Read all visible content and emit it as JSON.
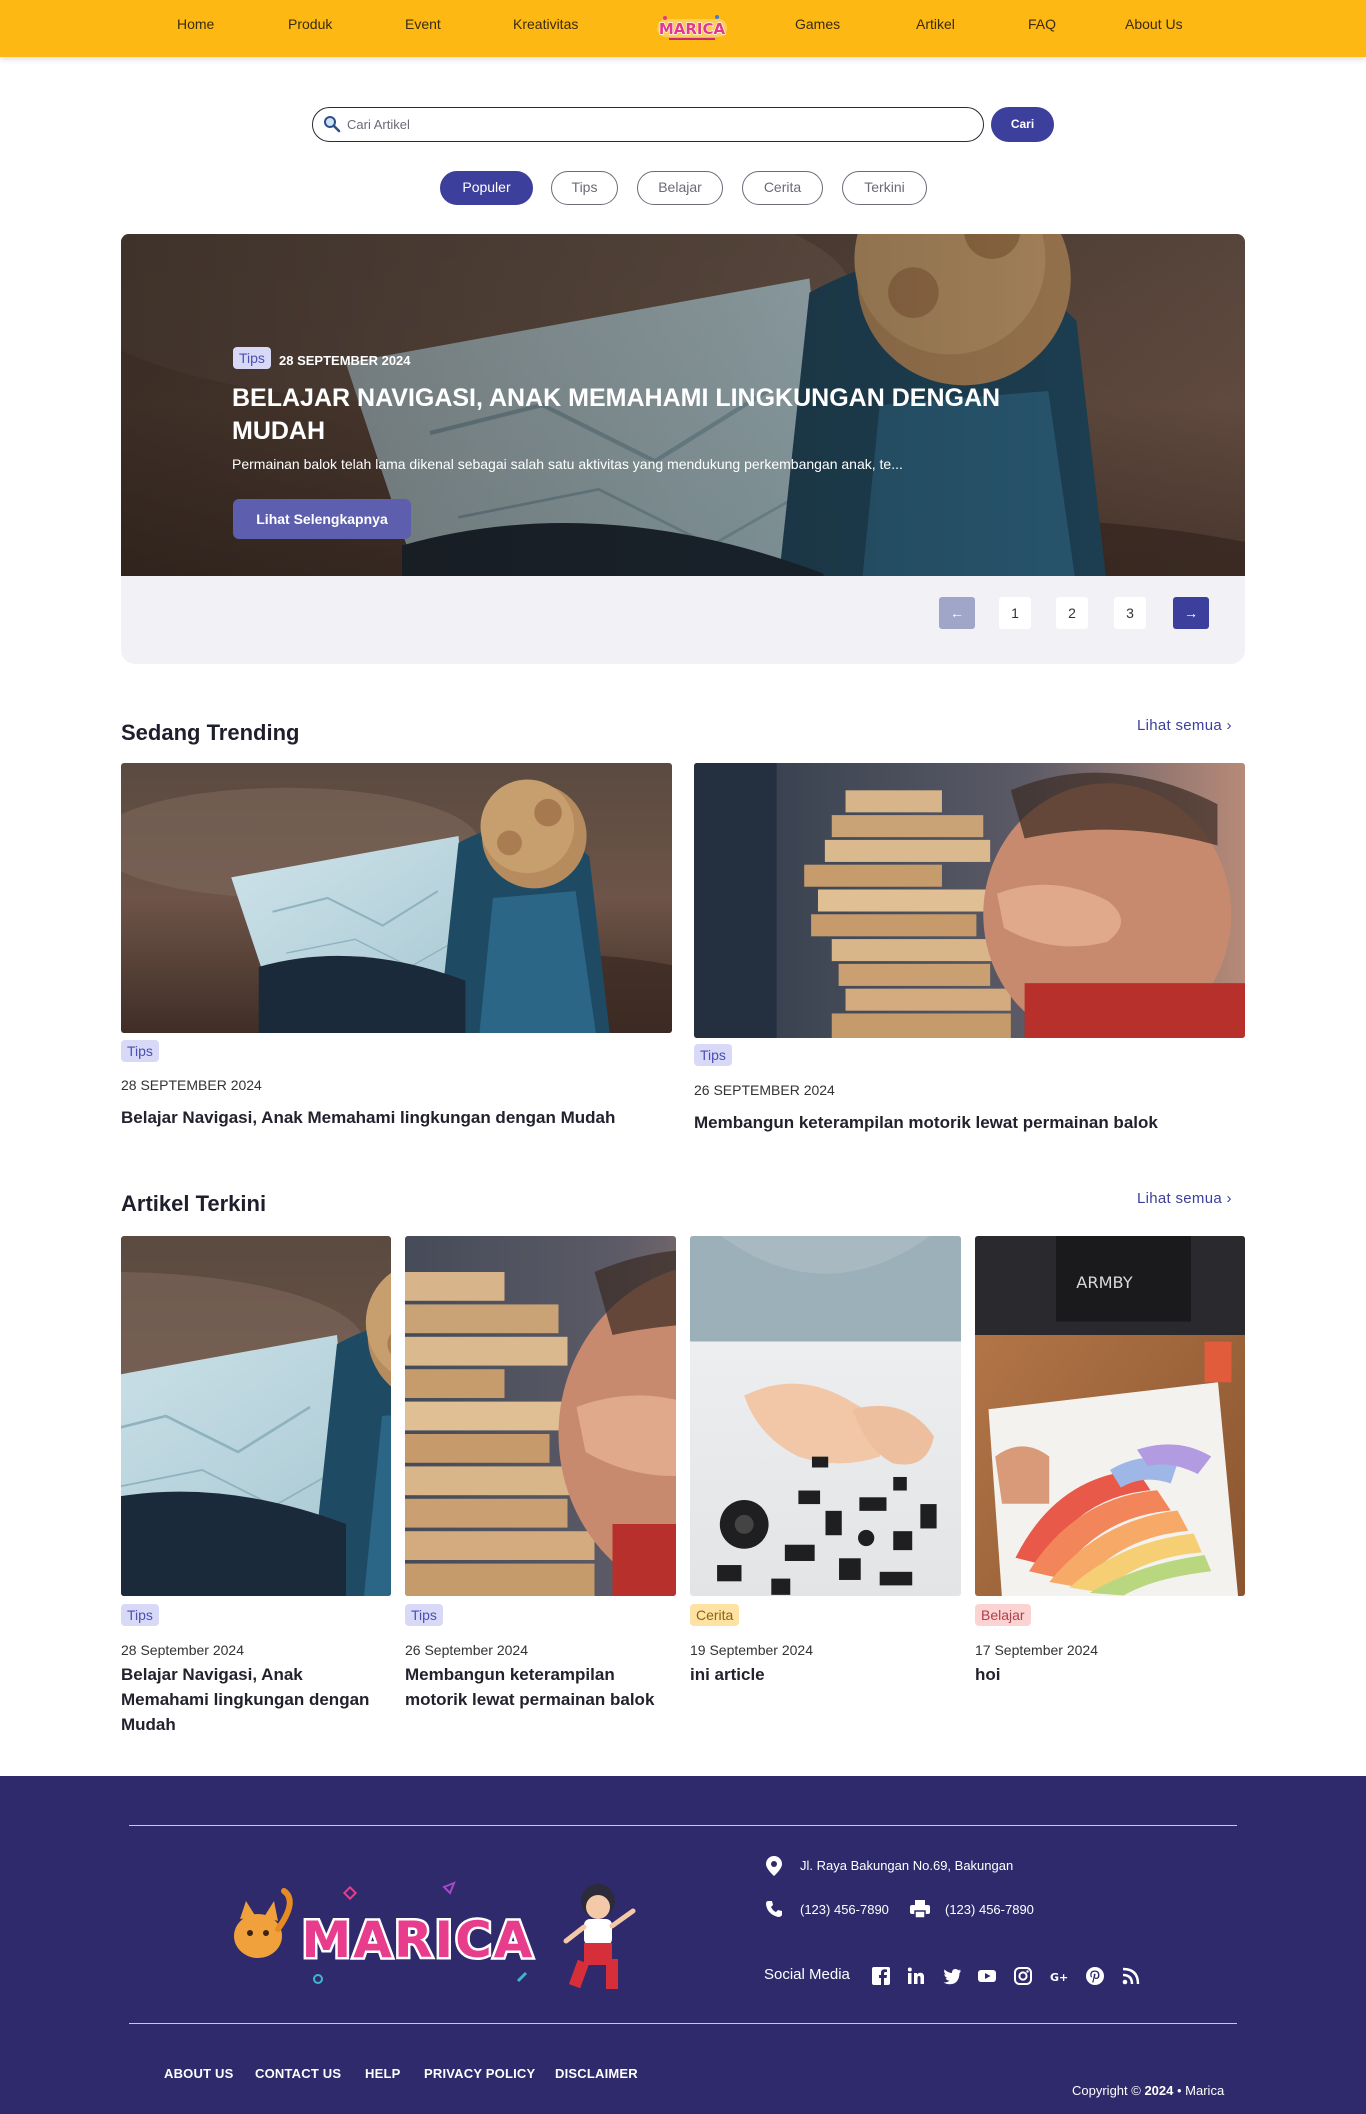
{
  "nav": {
    "items_left": [
      "Home",
      "Produk",
      "Event",
      "Kreativitas"
    ],
    "items_right": [
      "Games",
      "Artikel",
      "FAQ",
      "About Us"
    ],
    "logo_text": "MARICA"
  },
  "search": {
    "placeholder": "Cari Artikel",
    "button": "Cari"
  },
  "filters": [
    "Populer",
    "Tips",
    "Belajar",
    "Cerita",
    "Terkini"
  ],
  "active_filter": "Populer",
  "hero": {
    "tag": "Tips",
    "date": "28 SEPTEMBER 2024",
    "title": "BELAJAR NAVIGASI, ANAK MEMAHAMI LINGKUNGAN DENGAN MUDAH",
    "description": "Permainan balok telah lama dikenal sebagai salah satu aktivitas yang mendukung perkembangan anak, te...",
    "button": "Lihat Selengkapnya"
  },
  "pagination": {
    "prev": "←",
    "pages": [
      "1",
      "2",
      "3"
    ],
    "next": "→"
  },
  "trending": {
    "title": "Sedang Trending",
    "see_all": "Lihat semua ›",
    "cards": [
      {
        "tag": "Tips",
        "date": "28 SEPTEMBER 2024",
        "title": "Belajar Navigasi, Anak Memahami lingkungan dengan Mudah"
      },
      {
        "tag": "Tips",
        "date": "26 SEPTEMBER 2024",
        "title": "Membangun keterampilan motorik lewat permainan balok"
      }
    ]
  },
  "latest": {
    "title": "Artikel Terkini",
    "see_all": "Lihat semua ›",
    "cards": [
      {
        "tag": "Tips",
        "date": "28 September 2024",
        "title": "Belajar Navigasi, Anak Memahami lingkungan dengan Mudah"
      },
      {
        "tag": "Tips",
        "date": "26 September 2024",
        "title": "Membangun keterampilan motorik lewat permainan balok"
      },
      {
        "tag": "Cerita",
        "date": "19 September 2024",
        "title": "ini article"
      },
      {
        "tag": "Belajar",
        "date": "17 September 2024",
        "title": "hoi"
      }
    ]
  },
  "footer": {
    "logo_text": "MARICA",
    "address": "Jl. Raya Bakungan No.69, Bakungan",
    "phone": "(123) 456-7890",
    "fax": "(123) 456-7890",
    "social_label": "Social Media",
    "social_icons": [
      "facebook-icon",
      "linkedin-icon",
      "twitter-icon",
      "youtube-icon",
      "instagram-icon",
      "google-plus-icon",
      "pinterest-icon",
      "rss-icon"
    ],
    "links": [
      "ABOUT US",
      "CONTACT US",
      "HELP",
      "PRIVACY POLICY",
      "DISCLAIMER"
    ],
    "copyright_prefix": "Copyright ©",
    "copyright_year": "2024",
    "copyright_suffix": "• Marica"
  },
  "colors": {
    "nav_bg": "#fdb813",
    "accent": "#3d3f9c",
    "footer_bg": "#2f2a6b",
    "tag_tips": "#d8d9f7",
    "tag_cerita": "#fde2a3",
    "tag_belajar": "#fbd3d3"
  }
}
